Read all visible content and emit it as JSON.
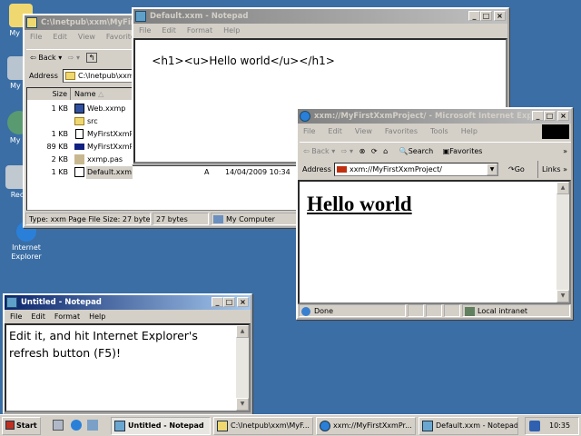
{
  "desktop": {
    "icons": [
      {
        "label": "My Documents",
        "short": "My Do"
      },
      {
        "label": "My Computer",
        "short": "My C"
      },
      {
        "label": "My Network Places",
        "short": "My N"
      },
      {
        "label": "Recycle Bin",
        "short": "Rec"
      },
      {
        "label1": "Internet",
        "label2": "Explorer"
      }
    ]
  },
  "explorer": {
    "title": "C:\\Inetpub\\xxm\\MyFirstXxmProject",
    "menu": [
      "File",
      "Edit",
      "View",
      "Favorites"
    ],
    "back_label": "Back",
    "address_label": "Address",
    "address_value": "C:\\Inetpub\\xxm\\MyFirstXxmProject",
    "columns": {
      "size": "Size",
      "name": "Name"
    },
    "files": [
      {
        "size": "1 KB",
        "name": "Web.xxmp",
        "icon": "app-icon"
      },
      {
        "size": "",
        "name": "src",
        "icon": "folder-icon"
      },
      {
        "size": "1 KB",
        "name": "MyFirstXxmProject.dpr",
        "icon": "text-file-icon"
      },
      {
        "size": "89 KB",
        "name": "MyFirstXxmProject.xxl",
        "icon": "dll-icon"
      },
      {
        "size": "2 KB",
        "name": "xxmp.pas",
        "icon": "pas-file-icon"
      },
      {
        "size": "1 KB",
        "name": "Default.xxm",
        "icon": "xxm-file-icon",
        "attr": "A",
        "modified": "14/04/2009 10:34"
      }
    ],
    "status": {
      "info": "Type: xxm Page File Size: 27 bytes",
      "size": "27 bytes",
      "zone": "My Computer"
    }
  },
  "notepad_default": {
    "title": "Default.xxm - Notepad",
    "menu": [
      "File",
      "Edit",
      "Format",
      "Help"
    ],
    "content": "<h1><u>Hello world</u></h1>"
  },
  "ie": {
    "title": "xxm://MyFirstXxmProject/ - Microsoft Internet Explorer",
    "menu": [
      "File",
      "Edit",
      "View",
      "Favorites",
      "Tools",
      "Help"
    ],
    "toolbar": {
      "back": "Back",
      "search": "Search",
      "favorites": "Favorites"
    },
    "address_label": "Address",
    "address_value": "xxm://MyFirstXxmProject/",
    "go": "Go",
    "links": "Links",
    "page_heading": "Hello world",
    "status": {
      "text": "Done",
      "zone": "Local intranet"
    }
  },
  "notepad_untitled": {
    "title": "Untitled - Notepad",
    "menu": [
      "File",
      "Edit",
      "Format",
      "Help"
    ],
    "content": "Edit it, and hit Internet Explorer's refresh button (F5)!"
  },
  "taskbar": {
    "start": "Start",
    "tasks": [
      "Untitled - Notepad",
      "C:\\Inetpub\\xxm\\MyF...",
      "xxm://MyFirstXxmPr...",
      "Default.xxm - Notepad"
    ],
    "clock": "10:35"
  }
}
